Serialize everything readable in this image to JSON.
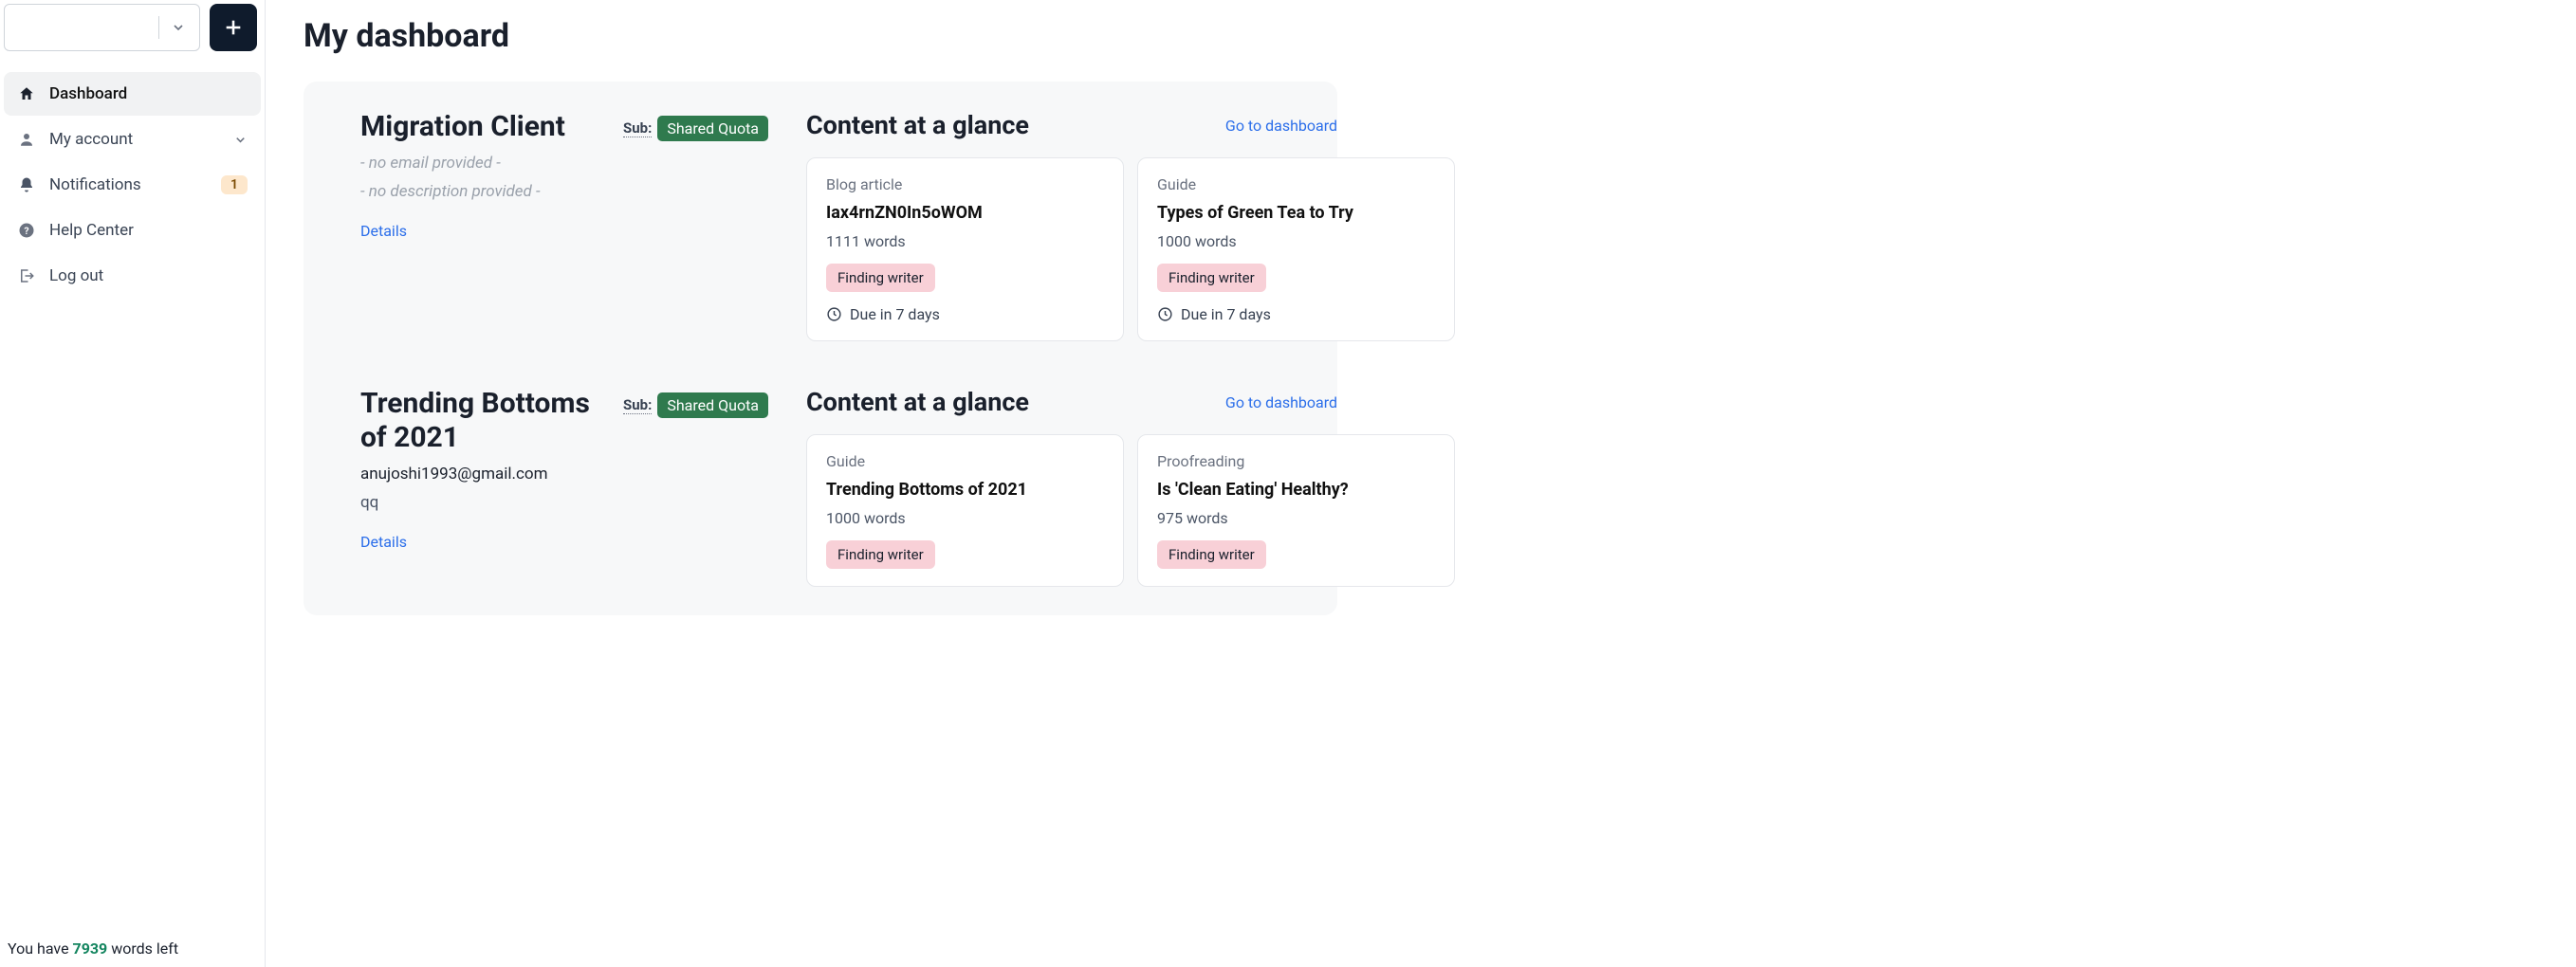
{
  "sidebar": {
    "items": [
      {
        "label": "Dashboard",
        "active": true
      },
      {
        "label": "My account",
        "hasChevron": true
      },
      {
        "label": "Notifications",
        "badge": "1"
      },
      {
        "label": "Help Center"
      },
      {
        "label": "Log out"
      }
    ],
    "footer": {
      "prefix": "You have ",
      "count": "7939",
      "suffix": " words left"
    }
  },
  "page": {
    "title": "My dashboard"
  },
  "clients": [
    {
      "name": "Migration Client",
      "subLabel": "Sub:",
      "quota": "Shared Quota",
      "emailText": "- no email provided -",
      "emailHas": false,
      "descText": "- no description provided -",
      "descHas": false,
      "detailsLabel": "Details",
      "glanceTitle": "Content at a glance",
      "gotoLabel": "Go to dashboard",
      "cards": [
        {
          "type": "Blog article",
          "title": "Iax4rnZN0In5oWOM",
          "words": "1111 words",
          "status": "Finding writer",
          "due": "Due in 7 days"
        },
        {
          "type": "Guide",
          "title": "Types of Green Tea to Try",
          "words": "1000 words",
          "status": "Finding writer",
          "due": "Due in 7 days"
        }
      ]
    },
    {
      "name": "Trending Bottoms of 2021",
      "subLabel": "Sub:",
      "quota": "Shared Quota",
      "emailText": "anujoshi1993@gmail.com",
      "emailHas": true,
      "descText": "qq",
      "descHas": true,
      "detailsLabel": "Details",
      "glanceTitle": "Content at a glance",
      "gotoLabel": "Go to dashboard",
      "cards": [
        {
          "type": "Guide",
          "title": "Trending Bottoms of 2021",
          "words": "1000 words",
          "status": "Finding writer"
        },
        {
          "type": "Proofreading",
          "title": "Is 'Clean Eating' Healthy?",
          "words": "975 words",
          "status": "Finding writer"
        }
      ]
    }
  ]
}
